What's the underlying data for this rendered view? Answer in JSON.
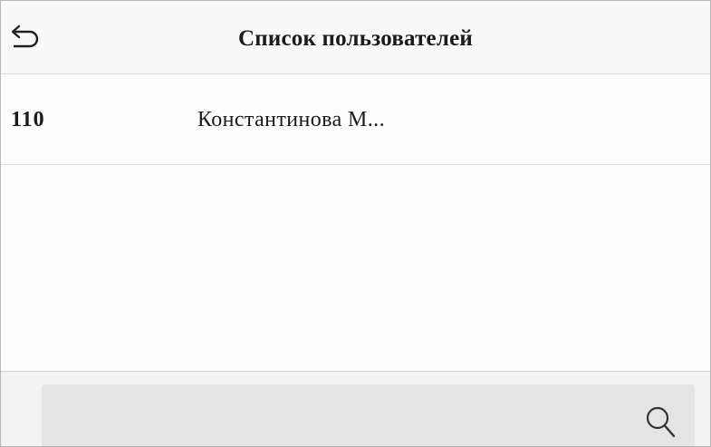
{
  "header": {
    "title": "Список пользователей",
    "back_icon": "back-arrow-icon"
  },
  "users": [
    {
      "id": "110",
      "name": "Константинова М..."
    }
  ],
  "search": {
    "value": "",
    "icon": "search-icon"
  },
  "colors": {
    "background": "#fcfcfc",
    "text": "#1b1b1b",
    "search_bar": "#e4e4e4",
    "divider": "#d8d8d8"
  }
}
